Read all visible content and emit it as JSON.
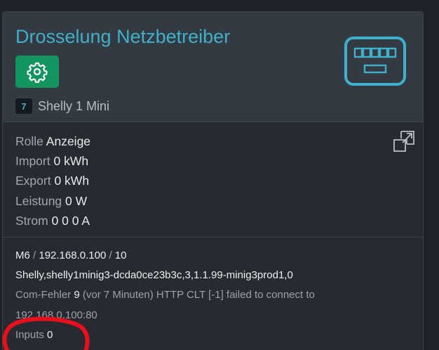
{
  "card": {
    "title": "Drosselung Netzbetreiber",
    "device_id": "7",
    "device_name": "Shelly 1 Mini",
    "colors": {
      "title": "#3fb0c9",
      "gear_button": "#13955f",
      "highlight": "#e8101c"
    }
  },
  "values": {
    "rolle_label": "Rolle",
    "rolle_value": "Anzeige",
    "import_label": "Import",
    "import_value": "0 kWh",
    "export_label": "Export",
    "export_value": "0 kWh",
    "leistung_label": "Leistung",
    "leistung_value": "0 W",
    "strom_label": "Strom",
    "strom_value": "0 0 0 A"
  },
  "info": {
    "model": "M6",
    "sep1": " / ",
    "ip": "192.168.0.100",
    "sep2": " / ",
    "slot": "10",
    "shelly_line": "Shelly,shelly1minig3-dcda0ce23b3c,3,1.1.99-minig3prod1,0",
    "error_label": "Com-Fehler ",
    "error_count": "9",
    "error_text_1": " (vor 7 Minuten) HTTP CLT [-1] failed to connect to",
    "error_text_2": "192.168.0.100:80",
    "inputs_label": "Inputs ",
    "inputs_value": "0"
  },
  "icons": [
    "gear-icon",
    "keyboard-icon",
    "popout-icon"
  ]
}
